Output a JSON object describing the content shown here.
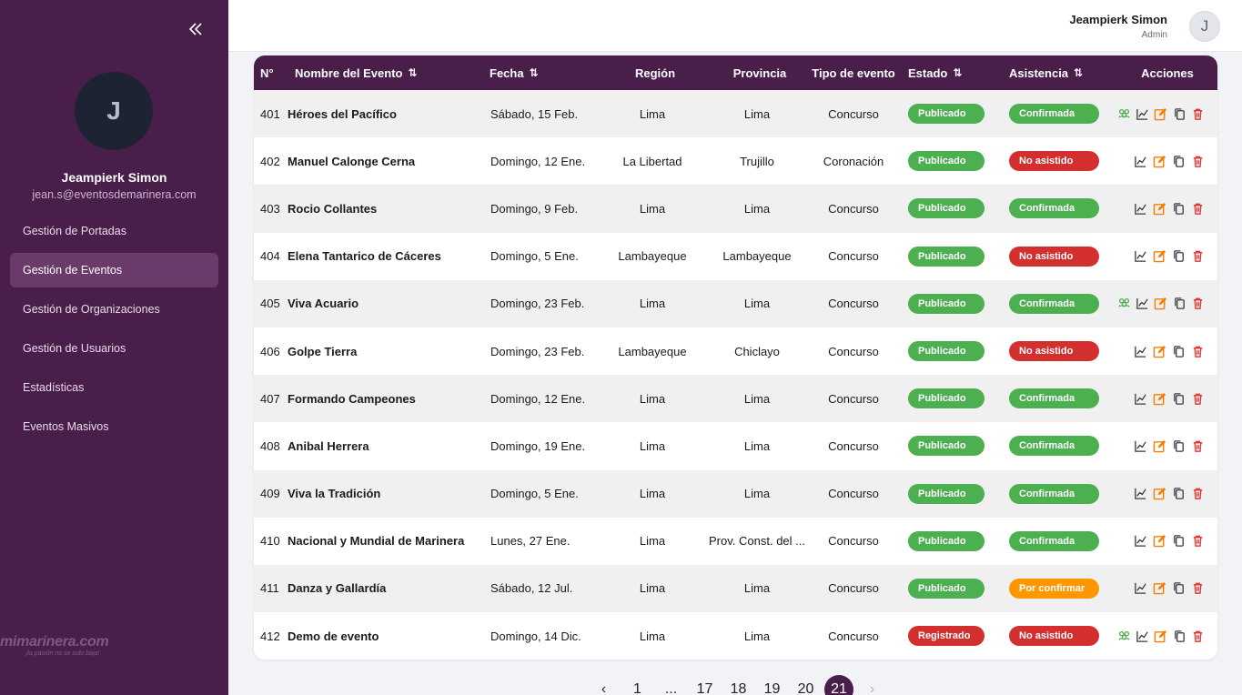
{
  "colors": {
    "sidebar": "#4a1e4b",
    "published": "#4caf50",
    "registered": "#d32f2f",
    "confirmed": "#4caf50",
    "absent": "#d32f2f",
    "pending": "#ff9800",
    "action_group": "#4caf50",
    "action_stats": "#3a3a3a",
    "action_edit": "#f57c00",
    "action_copy": "#3a3a3a",
    "action_delete": "#e53935"
  },
  "sidebar": {
    "avatar_initial": "J",
    "user_name": "Jeampierk Simon",
    "user_email": "jean.s@eventosdemarinera.com",
    "collapse_icon": "double-chevron-left-icon",
    "items": [
      {
        "label": "Gestión de Portadas",
        "active": false
      },
      {
        "label": "Gestión de Eventos",
        "active": true
      },
      {
        "label": "Gestión de Organizaciones",
        "active": false
      },
      {
        "label": "Gestión de Usuarios",
        "active": false
      },
      {
        "label": "Estadísticas",
        "active": false
      },
      {
        "label": "Eventos Masivos",
        "active": false
      }
    ],
    "brand": {
      "main": "mimarinera.com",
      "sub": "¡la pasión no se solo baja!"
    }
  },
  "topbar": {
    "user_name": "Jeampierk Simon",
    "user_role": "Admin",
    "avatar_initial": "J"
  },
  "table": {
    "columns": {
      "num": "N°",
      "name": "Nombre del Evento",
      "date": "Fecha",
      "region": "Región",
      "province": "Provincia",
      "type": "Tipo de evento",
      "status": "Estado",
      "attendance": "Asistencia",
      "actions": "Acciones"
    },
    "sort_icon": "⇅",
    "rows": [
      {
        "num": "401",
        "name": "Héroes del Pacífico",
        "date": "Sábado, 15 Feb.",
        "region": "Lima",
        "province": "Lima",
        "type": "Concurso",
        "status": "Publicado",
        "attendance": "Confirmada",
        "group": true
      },
      {
        "num": "402",
        "name": "Manuel Calonge Cerna",
        "date": "Domingo, 12 Ene.",
        "region": "La Libertad",
        "province": "Trujillo",
        "type": "Coronación",
        "status": "Publicado",
        "attendance": "No asistido",
        "group": false
      },
      {
        "num": "403",
        "name": "Rocio Collantes",
        "date": "Domingo, 9 Feb.",
        "region": "Lima",
        "province": "Lima",
        "type": "Concurso",
        "status": "Publicado",
        "attendance": "Confirmada",
        "group": false
      },
      {
        "num": "404",
        "name": "Elena Tantarico de Cáceres",
        "date": "Domingo, 5 Ene.",
        "region": "Lambayeque",
        "province": "Lambayeque",
        "type": "Concurso",
        "status": "Publicado",
        "attendance": "No asistido",
        "group": false
      },
      {
        "num": "405",
        "name": "Viva Acuario",
        "date": "Domingo, 23 Feb.",
        "region": "Lima",
        "province": "Lima",
        "type": "Concurso",
        "status": "Publicado",
        "attendance": "Confirmada",
        "group": true
      },
      {
        "num": "406",
        "name": "Golpe Tierra",
        "date": "Domingo, 23 Feb.",
        "region": "Lambayeque",
        "province": "Chiclayo",
        "type": "Concurso",
        "status": "Publicado",
        "attendance": "No asistido",
        "group": false
      },
      {
        "num": "407",
        "name": "Formando Campeones",
        "date": "Domingo, 12 Ene.",
        "region": "Lima",
        "province": "Lima",
        "type": "Concurso",
        "status": "Publicado",
        "attendance": "Confirmada",
        "group": false
      },
      {
        "num": "408",
        "name": "Anibal Herrera",
        "date": "Domingo, 19 Ene.",
        "region": "Lima",
        "province": "Lima",
        "type": "Concurso",
        "status": "Publicado",
        "attendance": "Confirmada",
        "group": false
      },
      {
        "num": "409",
        "name": "Viva la Tradición",
        "date": "Domingo, 5 Ene.",
        "region": "Lima",
        "province": "Lima",
        "type": "Concurso",
        "status": "Publicado",
        "attendance": "Confirmada",
        "group": false
      },
      {
        "num": "410",
        "name": "Nacional y Mundial de Marinera",
        "date": "Lunes, 27 Ene.",
        "region": "Lima",
        "province": "Prov. Const. del ...",
        "type": "Concurso",
        "status": "Publicado",
        "attendance": "Confirmada",
        "group": false
      },
      {
        "num": "411",
        "name": "Danza y Gallardía",
        "date": "Sábado, 12 Jul.",
        "region": "Lima",
        "province": "Lima",
        "type": "Concurso",
        "status": "Publicado",
        "attendance": "Por confirmar",
        "group": false
      },
      {
        "num": "412",
        "name": "Demo de evento",
        "date": "Domingo, 14 Dic.",
        "region": "Lima",
        "province": "Lima",
        "type": "Concurso",
        "status": "Registrado",
        "attendance": "No asistido",
        "group": true
      }
    ]
  },
  "pagination": {
    "prev": "‹",
    "next": "›",
    "pages": [
      "1",
      "...",
      "17",
      "18",
      "19",
      "20",
      "21"
    ],
    "current": "21"
  }
}
